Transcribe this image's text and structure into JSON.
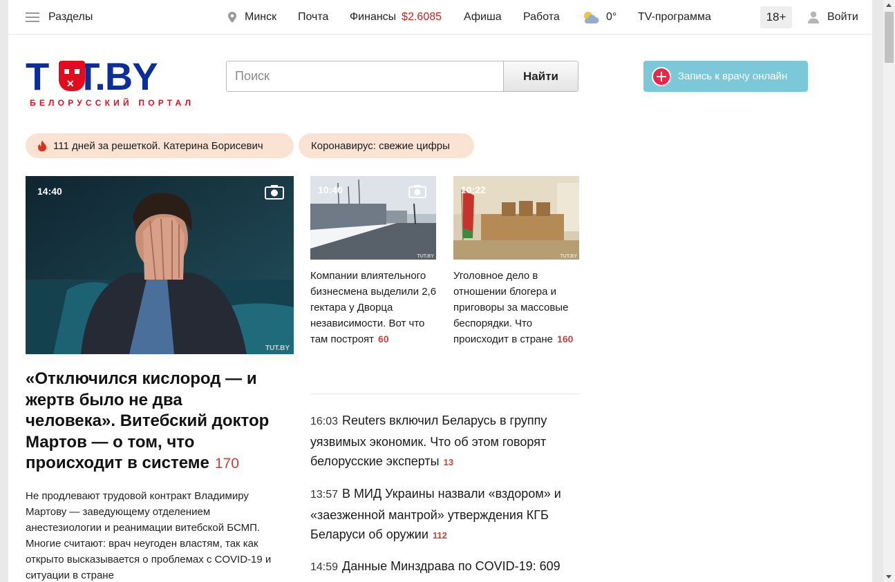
{
  "topbar": {
    "sections_label": "Разделы",
    "city": "Минск",
    "mail": "Почта",
    "finance_label": "Финансы",
    "finance_value": "$2.6085",
    "afisha": "Афиша",
    "rabota": "Работа",
    "temperature": "0°",
    "tv": "TV-программа",
    "age": "18+",
    "login": "Войти",
    "icons": [
      "menu-icon",
      "location-pin-icon",
      "partly-cloudy-icon",
      "user-icon"
    ]
  },
  "logo": {
    "word_left": "T",
    "word_right": "T.BY",
    "subtitle": "БЕЛОРУССКИЙ ПОРТАЛ"
  },
  "search": {
    "placeholder": "Поиск",
    "button": "Найти"
  },
  "doctor_button": "Запись к врачу онлайн",
  "chips": [
    {
      "label": "111 дней за решеткой. Катерина Борисевич",
      "icon": "fire-icon"
    },
    {
      "label": "Коронавирус: свежие цифры"
    }
  ],
  "main_story": {
    "time": "14:40",
    "title": "«Отключился кислород — и жертв было не два человека». Витебский доктор Мартов — о том, что происходит в системе",
    "comments": "170",
    "lead": "Не продлевают трудовой контракт Владимиру Мартову — заведующему отделением анестезиологии и реанимации витебской БСМП. Многие считают: врач неугоден властям, так как открыто высказывается о проблемах с COVID-19 и ситуации в стране",
    "watermark": "TUT.BY"
  },
  "cards": [
    {
      "time": "10:40",
      "title": "Компании влиятельного бизнесмена выделили 2,6 гектара у Дворца независимости. Вот что там построят",
      "comments": "60",
      "watermark": "TUT.BY"
    },
    {
      "time": "10:22",
      "title": "Уголовное дело в отношении блогера и приговоры за массовые беспорядки. Что происходит в стране",
      "comments": "160",
      "watermark": "TUT.BY"
    }
  ],
  "news": [
    {
      "time": "16:03",
      "title": "Reuters включил Беларусь в группу уязвимых экономик. Что об этом говорят белорусские эксперты",
      "comments": "13"
    },
    {
      "time": "13:57",
      "title": "В МИД Украины назвали «вздором» и «заезженной мантрой» утверждения КГБ Беларуси об оружии",
      "comments": "112"
    },
    {
      "time": "14:59",
      "title": "Данные Минздрава по COVID-19: 609",
      "comments": ""
    }
  ],
  "colors": {
    "accent_red": "#c4251c",
    "logo_blue": "#0c2e99",
    "chip_bg": "#fbe3d4",
    "doctor_bg": "#7cc8d8"
  }
}
